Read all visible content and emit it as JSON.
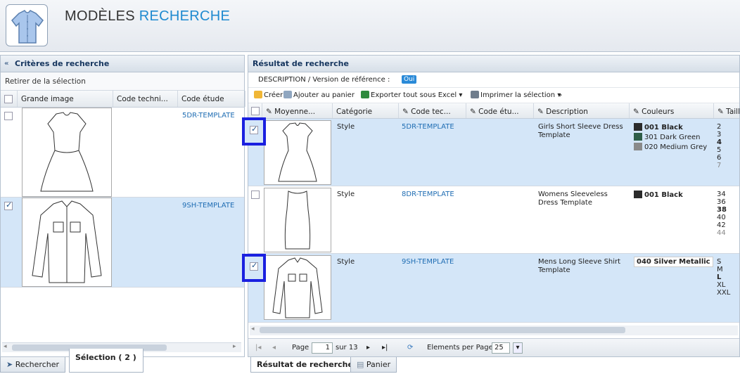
{
  "header": {
    "title_part1": "MODÈLES",
    "title_part2": "RECHERCHE"
  },
  "left_panel": {
    "title": "Critères de recherche",
    "remove_selection": "Retirer de la sélection",
    "columns": [
      "Grande image",
      "Code techni...",
      "Code étude"
    ],
    "rows": [
      {
        "code": "5DR-TEMPLATE",
        "checked": false
      },
      {
        "code": "9SH-TEMPLATE",
        "checked": true
      }
    ]
  },
  "right_panel": {
    "title": "Résultat de recherche",
    "desc_label": "DESCRIPTION / Version de référence :",
    "desc_value": "Oui",
    "toolbar": {
      "create": "Créer",
      "add_cart": "Ajouter au panier",
      "export": "Exporter tout sous Excel",
      "print": "Imprimer la sélection",
      "more": "»"
    },
    "columns": [
      "Moyenne...",
      "Catégorie",
      "Code tec...",
      "Code étu...",
      "Description",
      "Couleurs",
      "Taille"
    ],
    "rows": [
      {
        "category": "Style",
        "code": "5DR-TEMPLATE",
        "desc": "Girls Short Sleeve Dress Template",
        "colors": [
          "001 Black",
          "301 Dark Green",
          "020 Medium Grey"
        ],
        "color_hex": [
          "#2b2b2b",
          "#2f5e48",
          "#8a8a8a"
        ],
        "sizes": [
          "2",
          "3",
          "4",
          "5",
          "6",
          "7"
        ],
        "checked": true
      },
      {
        "category": "Style",
        "code": "8DR-TEMPLATE",
        "desc": "Womens Sleeveless Dress Template",
        "colors": [
          "001 Black"
        ],
        "color_hex": [
          "#2b2b2b"
        ],
        "sizes": [
          "34",
          "36",
          "38",
          "40",
          "42",
          "44"
        ],
        "checked": false
      },
      {
        "category": "Style",
        "code": "9SH-TEMPLATE",
        "desc": "Mens Long Sleeve Shirt Template",
        "colors": [
          "040 Silver Metallic"
        ],
        "sizes": [
          "S",
          "M",
          "L",
          "XL",
          "XXL"
        ],
        "checked": true
      }
    ],
    "pager": {
      "page_label": "Page",
      "page_value": "1",
      "of_label": "sur 13",
      "per_page_label": "Elements per Page",
      "per_page_value": "25"
    }
  },
  "bottom_tabs": {
    "search": "Rechercher",
    "selection": "Sélection ( 2 )",
    "results": "Résultat de recherche",
    "cart": "Panier"
  }
}
